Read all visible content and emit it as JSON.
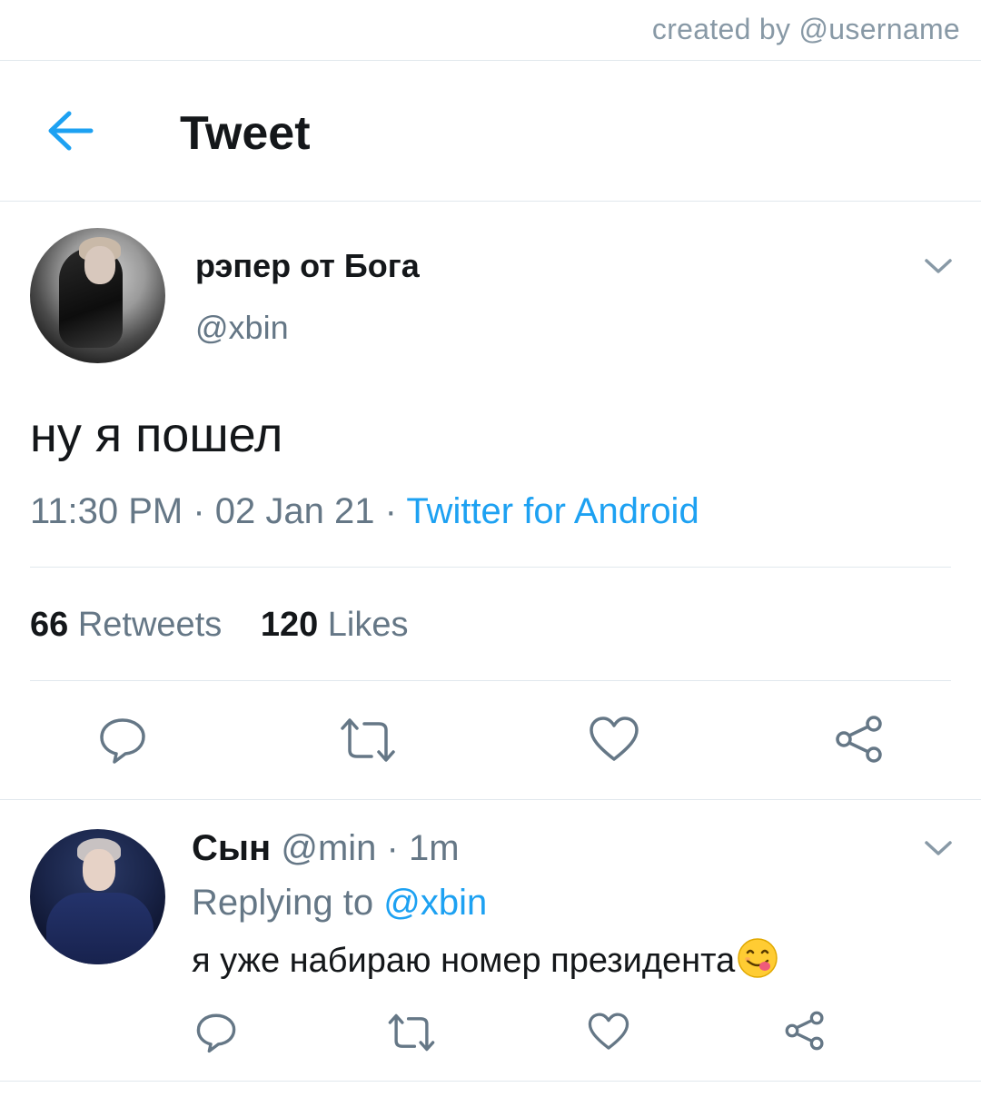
{
  "watermark": "created by @username",
  "header": {
    "title": "Tweet",
    "back_icon": "arrow-left-icon"
  },
  "tweet": {
    "display_name": "рэпер от Бога",
    "handle": "@xbin",
    "text": "ну я пошел",
    "time": "11:30 PM",
    "date": "02 Jan 21",
    "meta_sep": " · ",
    "source": "Twitter for Android",
    "retweets_count": "66",
    "retweets_label": "Retweets",
    "likes_count": "120",
    "likes_label": "Likes",
    "actions": [
      "reply-icon",
      "retweet-icon",
      "like-icon",
      "share-icon"
    ]
  },
  "reply": {
    "display_name": "Сын",
    "handle": "@min",
    "time_sep": " · ",
    "time": "1m",
    "replying_prefix": "Replying to ",
    "replying_to": "@xbin",
    "text": "я уже набираю номер президента",
    "emoji": "yum-face-emoji",
    "actions": [
      "reply-icon",
      "retweet-icon",
      "like-icon",
      "share-icon"
    ]
  },
  "colors": {
    "accent": "#1da1f2",
    "secondary_text": "#657786",
    "primary_text": "#14171a",
    "divider": "#e1e8ed"
  }
}
